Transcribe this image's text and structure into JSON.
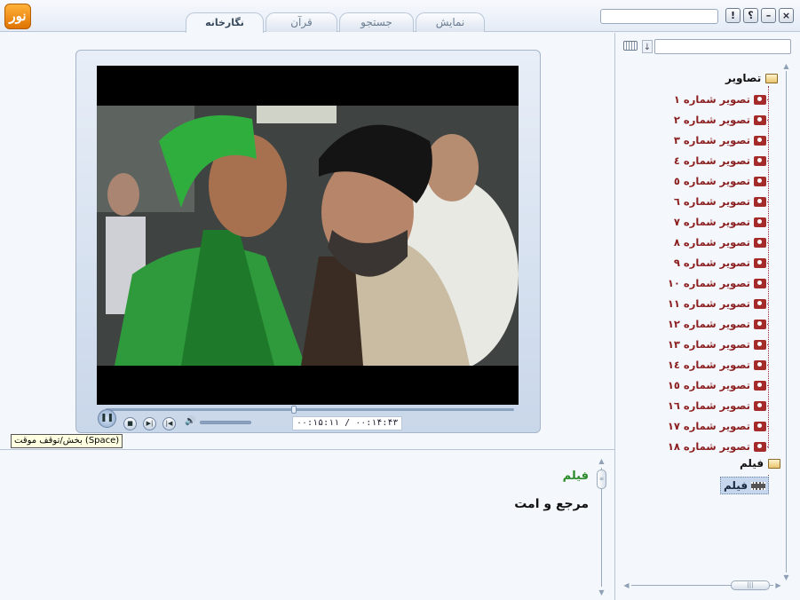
{
  "window": {
    "logo_text": "نور",
    "tabs": [
      {
        "label": "نمایش"
      },
      {
        "label": "جستجو"
      },
      {
        "label": "قرآن"
      },
      {
        "label": "نگارخانه",
        "active": true
      }
    ],
    "controls": {
      "help": "؟",
      "info": "!",
      "minimize": "–",
      "close": "×"
    }
  },
  "tree": {
    "folders": [
      {
        "label": "تصاویر"
      },
      {
        "label": "فیلم"
      }
    ],
    "images": [
      "تصویر شماره ۱",
      "تصویر شماره ۲",
      "تصویر شماره ۳",
      "تصویر شماره ٤",
      "تصویر شماره ٥",
      "تصویر شماره ٦",
      "تصویر شماره ۷",
      "تصویر شماره ۸",
      "تصویر شماره ۹",
      "تصویر شماره ۱۰",
      "تصویر شماره ۱۱",
      "تصویر شماره ۱۲",
      "تصویر شماره ۱۳",
      "تصویر شماره ۱٤",
      "تصویر شماره ۱٥",
      "تصویر شماره ۱٦",
      "تصویر شماره ۱۷",
      "تصویر شماره ۱۸"
    ],
    "film_item": "فیلم",
    "selected": "فیلم"
  },
  "player": {
    "time_display": "۰۰:۱۵:۱۱ / ۰۰:۱۴:۴۳",
    "progress": 0.46,
    "volume": 1.0,
    "tooltip": "بخش/توقف موقت (Space)"
  },
  "info": {
    "title": "فیلم",
    "body": "مرجع و امت"
  },
  "colors": {
    "image_item": "#8b1f1f",
    "info_title": "#2a8a2a",
    "selection": "#c6d6ec"
  }
}
